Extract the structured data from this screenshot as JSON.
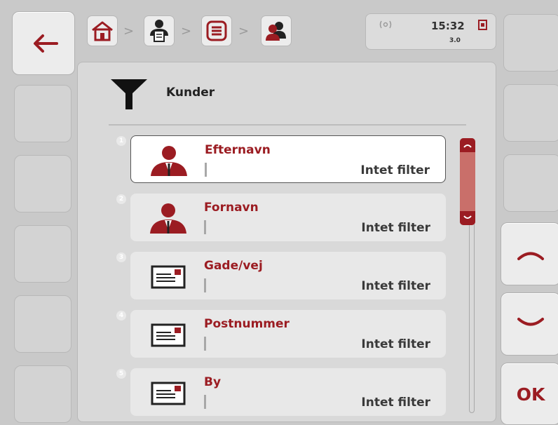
{
  "header": {
    "breadcrumb": [
      {
        "icon": "home-icon"
      },
      {
        "icon": "terminal-user-icon"
      },
      {
        "icon": "list-menu-icon"
      },
      {
        "icon": "customers-icon"
      }
    ],
    "separator": ">",
    "status": {
      "time": "15:32",
      "version": "3.0",
      "signal_icon": "antenna-icon",
      "sd_icon": "memory-card-icon"
    }
  },
  "filter": {
    "icon": "filter-funnel-icon",
    "title": "Kunder"
  },
  "rows": [
    {
      "num": "1",
      "icon": "person-icon",
      "title": "Efternavn",
      "value": "Intet filter"
    },
    {
      "num": "2",
      "icon": "person-icon",
      "title": "Fornavn",
      "value": "Intet filter"
    },
    {
      "num": "3",
      "icon": "text-field-icon",
      "title": "Gade/vej",
      "value": "Intet filter"
    },
    {
      "num": "4",
      "icon": "text-field-icon",
      "title": "Postnummer",
      "value": "Intet filter"
    },
    {
      "num": "5",
      "icon": "text-field-icon",
      "title": "By",
      "value": "Intet filter"
    }
  ],
  "softkeys": {
    "ok_label": "OK"
  },
  "colors": {
    "accent": "#9b1c22",
    "scrollbar": "#c96f6a",
    "background": "#c9c9c9"
  }
}
